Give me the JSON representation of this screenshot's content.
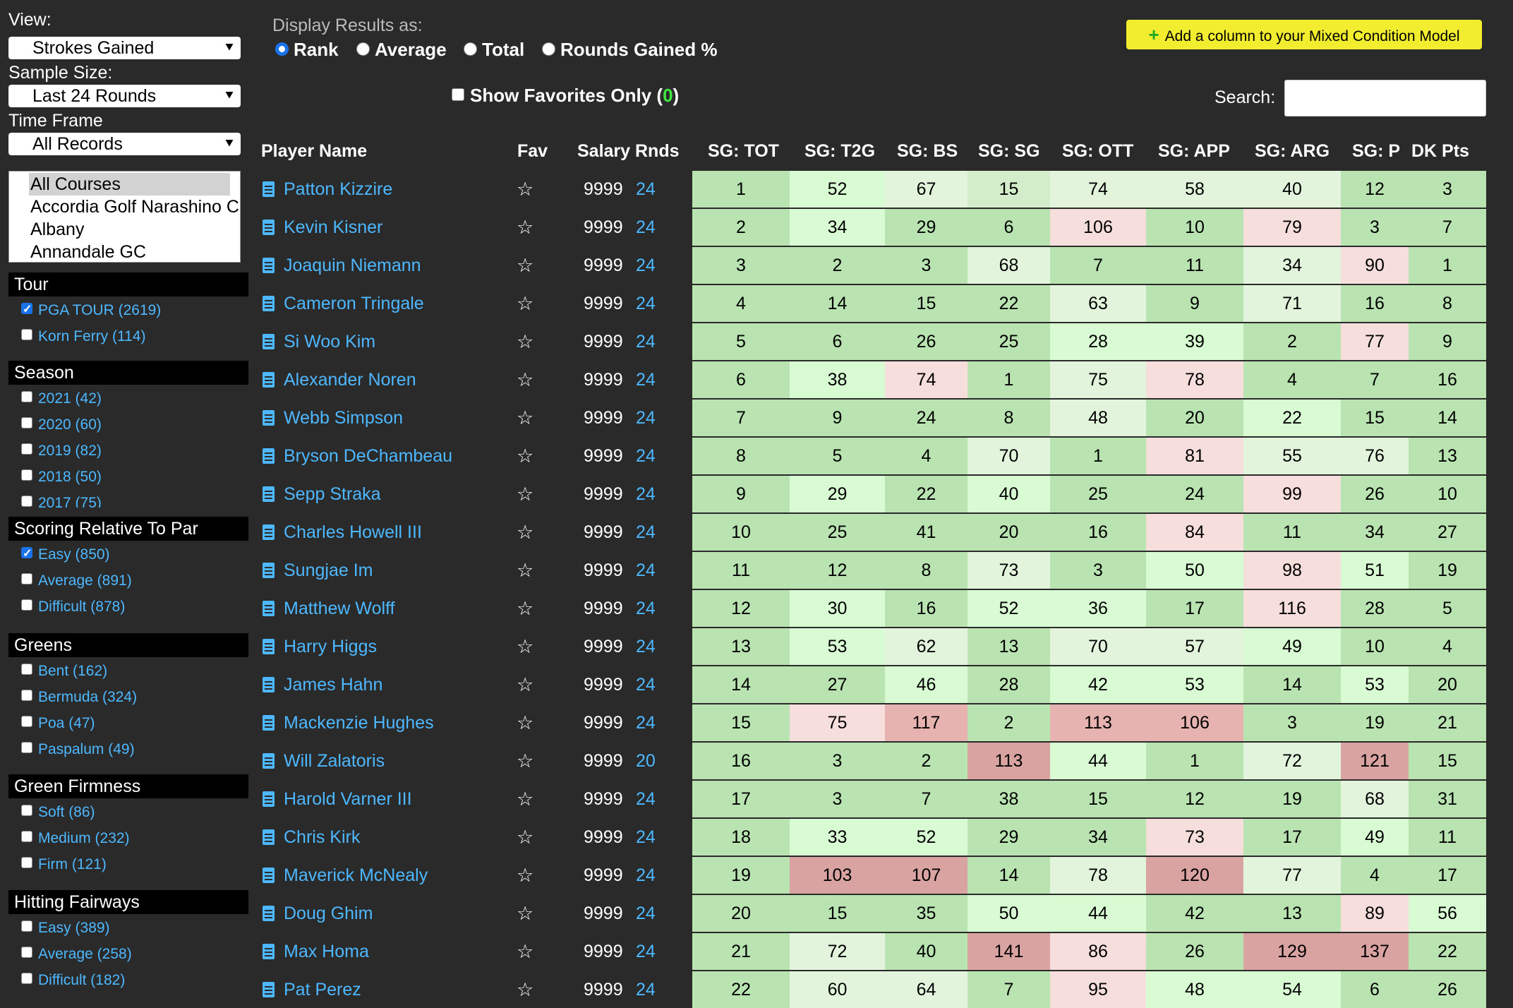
{
  "sidebar": {
    "view_label": "View:",
    "view_value": "Strokes Gained",
    "sample_label": "Sample Size:",
    "sample_value": "Last 24 Rounds",
    "timeframe_label": "Time Frame",
    "timeframe_value": "All Records",
    "courses": [
      "All Courses",
      "Accordia Golf Narashino C",
      "Albany",
      "Annandale GC"
    ],
    "sections": [
      {
        "title": "Tour",
        "items": [
          {
            "label": "PGA TOUR (2619)",
            "checked": true
          },
          {
            "label": "Korn Ferry (114)",
            "checked": false
          }
        ]
      },
      {
        "title": "Season",
        "items": [
          {
            "label": "2021 (42)",
            "checked": false
          },
          {
            "label": "2020 (60)",
            "checked": false
          },
          {
            "label": "2019 (82)",
            "checked": false
          },
          {
            "label": "2018 (50)",
            "checked": false
          },
          {
            "label": "2017 (75)",
            "checked": false
          }
        ]
      },
      {
        "title": "Scoring Relative To Par",
        "items": [
          {
            "label": "Easy (850)",
            "checked": true
          },
          {
            "label": "Average (891)",
            "checked": false
          },
          {
            "label": "Difficult (878)",
            "checked": false
          }
        ]
      },
      {
        "title": "Greens",
        "items": [
          {
            "label": "Bent (162)",
            "checked": false
          },
          {
            "label": "Bermuda (324)",
            "checked": false
          },
          {
            "label": "Poa (47)",
            "checked": false
          },
          {
            "label": "Paspalum (49)",
            "checked": false
          }
        ]
      },
      {
        "title": "Green Firmness",
        "items": [
          {
            "label": "Soft (86)",
            "checked": false
          },
          {
            "label": "Medium (232)",
            "checked": false
          },
          {
            "label": "Firm (121)",
            "checked": false
          }
        ]
      },
      {
        "title": "Hitting Fairways",
        "items": [
          {
            "label": "Easy (389)",
            "checked": false
          },
          {
            "label": "Average (258)",
            "checked": false
          },
          {
            "label": "Difficult (182)",
            "checked": false
          }
        ]
      }
    ]
  },
  "display": {
    "label": "Display Results as:",
    "options": [
      "Rank",
      "Average",
      "Total",
      "Rounds Gained %"
    ],
    "selected": "Rank"
  },
  "favorites": {
    "label": "Show Favorites Only (",
    "count": "0",
    "close": ")"
  },
  "add_column_label": "Add a column to your Mixed Condition Model",
  "search_label": "Search:",
  "search_value": "",
  "columns": [
    "Player Name",
    "Fav",
    "Salary",
    "Rnds",
    "SG: TOT",
    "SG: T2G",
    "SG: BS",
    "SG: SG",
    "SG: OTT",
    "SG: APP",
    "SG: ARG",
    "SG: P",
    "DK Pts"
  ],
  "icons": {
    "player_doc": "document-icon",
    "favorite": "star-outline-icon",
    "dropdown": "chevron-down-icon"
  },
  "players": [
    {
      "name": "Patton Kizzire",
      "salary": "9999",
      "rnds": "24",
      "stats": [
        1,
        52,
        67,
        15,
        74,
        58,
        40,
        12,
        3
      ]
    },
    {
      "name": "Kevin Kisner",
      "salary": "9999",
      "rnds": "24",
      "stats": [
        2,
        34,
        29,
        6,
        106,
        10,
        79,
        3,
        7
      ]
    },
    {
      "name": "Joaquin Niemann",
      "salary": "9999",
      "rnds": "24",
      "stats": [
        3,
        2,
        3,
        68,
        7,
        11,
        34,
        90,
        1
      ]
    },
    {
      "name": "Cameron Tringale",
      "salary": "9999",
      "rnds": "24",
      "stats": [
        4,
        14,
        15,
        22,
        63,
        9,
        71,
        16,
        8
      ]
    },
    {
      "name": "Si Woo Kim",
      "salary": "9999",
      "rnds": "24",
      "stats": [
        5,
        6,
        26,
        25,
        28,
        39,
        2,
        77,
        9
      ]
    },
    {
      "name": "Alexander Noren",
      "salary": "9999",
      "rnds": "24",
      "stats": [
        6,
        38,
        74,
        1,
        75,
        78,
        4,
        7,
        16
      ]
    },
    {
      "name": "Webb Simpson",
      "salary": "9999",
      "rnds": "24",
      "stats": [
        7,
        9,
        24,
        8,
        48,
        20,
        22,
        15,
        14
      ]
    },
    {
      "name": "Bryson DeChambeau",
      "salary": "9999",
      "rnds": "24",
      "stats": [
        8,
        5,
        4,
        70,
        1,
        81,
        55,
        76,
        13
      ]
    },
    {
      "name": "Sepp Straka",
      "salary": "9999",
      "rnds": "24",
      "stats": [
        9,
        29,
        22,
        40,
        25,
        24,
        99,
        26,
        10
      ]
    },
    {
      "name": "Charles Howell III",
      "salary": "9999",
      "rnds": "24",
      "stats": [
        10,
        25,
        41,
        20,
        16,
        84,
        11,
        34,
        27
      ]
    },
    {
      "name": "Sungjae Im",
      "salary": "9999",
      "rnds": "24",
      "stats": [
        11,
        12,
        8,
        73,
        3,
        50,
        98,
        51,
        19
      ]
    },
    {
      "name": "Matthew Wolff",
      "salary": "9999",
      "rnds": "24",
      "stats": [
        12,
        30,
        16,
        52,
        36,
        17,
        116,
        28,
        5
      ]
    },
    {
      "name": "Harry Higgs",
      "salary": "9999",
      "rnds": "24",
      "stats": [
        13,
        53,
        62,
        13,
        70,
        57,
        49,
        10,
        4
      ]
    },
    {
      "name": "James Hahn",
      "salary": "9999",
      "rnds": "24",
      "stats": [
        14,
        27,
        46,
        28,
        42,
        53,
        14,
        53,
        20
      ]
    },
    {
      "name": "Mackenzie Hughes",
      "salary": "9999",
      "rnds": "24",
      "stats": [
        15,
        75,
        117,
        2,
        113,
        106,
        3,
        19,
        21
      ]
    },
    {
      "name": "Will Zalatoris",
      "salary": "9999",
      "rnds": "20",
      "stats": [
        16,
        3,
        2,
        113,
        44,
        1,
        72,
        121,
        15
      ]
    },
    {
      "name": "Harold Varner III",
      "salary": "9999",
      "rnds": "24",
      "stats": [
        17,
        3,
        7,
        38,
        15,
        12,
        19,
        68,
        31
      ]
    },
    {
      "name": "Chris Kirk",
      "salary": "9999",
      "rnds": "24",
      "stats": [
        18,
        33,
        52,
        29,
        34,
        73,
        17,
        49,
        11
      ]
    },
    {
      "name": "Maverick McNealy",
      "salary": "9999",
      "rnds": "24",
      "stats": [
        19,
        103,
        107,
        14,
        78,
        120,
        77,
        4,
        17
      ]
    },
    {
      "name": "Doug Ghim",
      "salary": "9999",
      "rnds": "24",
      "stats": [
        20,
        15,
        35,
        50,
        44,
        42,
        13,
        89,
        56
      ]
    },
    {
      "name": "Max Homa",
      "salary": "9999",
      "rnds": "24",
      "stats": [
        21,
        72,
        40,
        141,
        86,
        26,
        129,
        137,
        22
      ]
    },
    {
      "name": "Pat Perez",
      "salary": "9999",
      "rnds": "24",
      "stats": [
        22,
        60,
        64,
        7,
        95,
        48,
        54,
        6,
        26
      ]
    }
  ],
  "colors": {
    "strong_green": "#b9e3b0",
    "green": "#d3ecca",
    "pale_green": "#e2f5dc",
    "bright_green": "#d9fbd4",
    "pale_red": "#f6dedd",
    "red": "#e6b3b1",
    "strong_red": "#d9a3a1"
  }
}
